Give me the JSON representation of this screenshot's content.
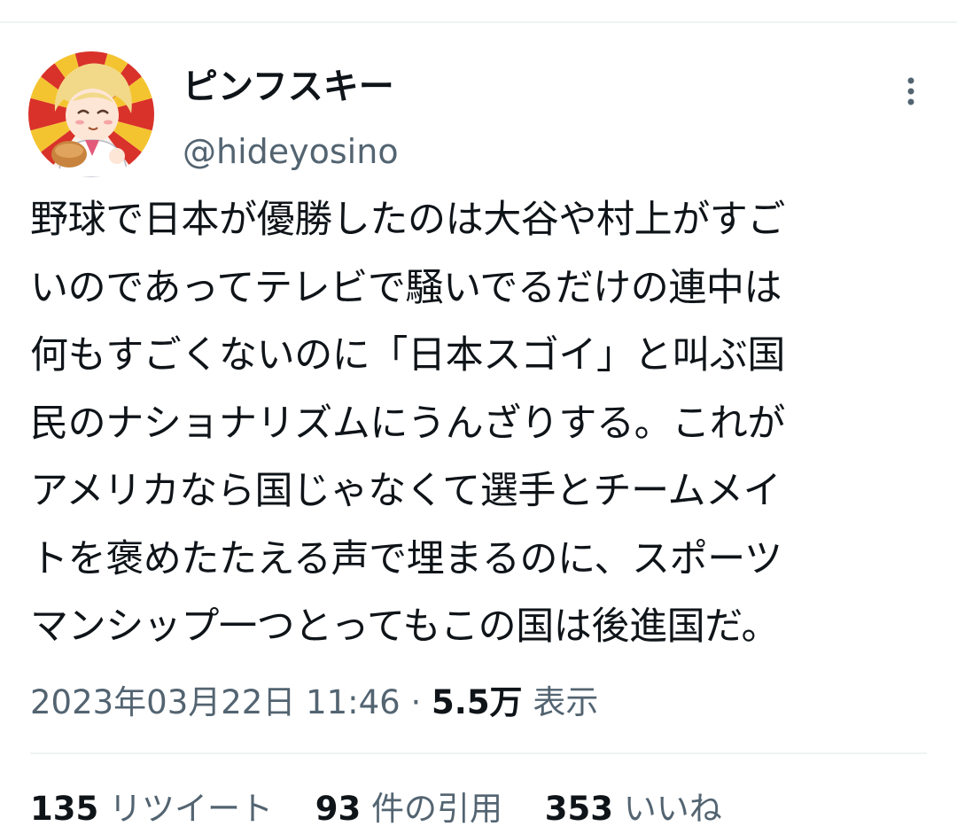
{
  "user": {
    "display_name": "ピンフスキー",
    "handle": "@hideyosino"
  },
  "tweet": {
    "lines": [
      "野球で日本が優勝したのは大谷や村上がすご",
      "いのであってテレビで騒いでるだけの連中は",
      "何もすごくないのに「日本スゴイ」と叫ぶ国",
      "民のナショナリズムにうんざりする。これが",
      "アメリカなら国じゃなくて選手とチームメイ",
      "トを褒めたたえる声で埋まるのに、スポーツ",
      "マンシップ一つとってもこの国は後進国だ。"
    ]
  },
  "meta": {
    "timestamp": "2023年03月22日 11:46",
    "separator": "·",
    "views_count": "5.5万",
    "views_label": "表示"
  },
  "stats": {
    "retweets_count": "135",
    "retweets_label": "リツイート",
    "quotes_count": "93",
    "quotes_label": "件の引用",
    "likes_count": "353",
    "likes_label": "いいね"
  },
  "icons": {
    "more": "more-vertical-icon"
  },
  "colors": {
    "text_primary": "#0f1419",
    "text_secondary": "#536471",
    "divider": "#eff3f4",
    "avatar_sun_red": "#d9322a",
    "avatar_sun_yellow": "#f4c430"
  }
}
